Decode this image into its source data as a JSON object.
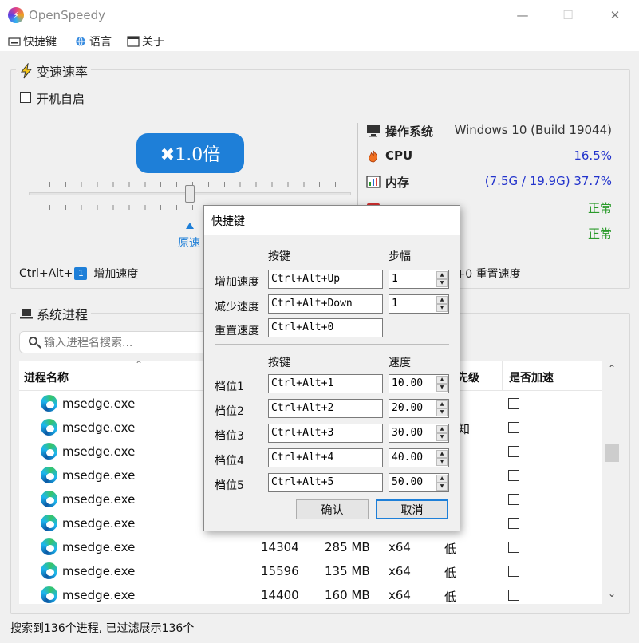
{
  "app": {
    "title": "OpenSpeedy",
    "logo_glyph": "⚡"
  },
  "window_controls": {
    "minimize": "—",
    "maximize": "☐",
    "close": "✕"
  },
  "menu": [
    {
      "label": "快捷键",
      "icon": "keyboard-icon"
    },
    {
      "label": "语言",
      "icon": "globe-icon"
    },
    {
      "label": "关于",
      "icon": "window-icon"
    }
  ],
  "speed_panel": {
    "title": "变速速率",
    "autostart_label": "开机自启",
    "autostart_checked": false,
    "speed_label": "✖1.0倍",
    "speed_value": 1.0,
    "slider_fraction": 0.5,
    "marker_label": "原速",
    "hotkey_prefix": "Ctrl+Alt+",
    "hotkey_key": "1",
    "hotkey_action": "增加速度",
    "reset_hotkey": "t+0 重置速度"
  },
  "system": {
    "rows": [
      {
        "label": "操作系统",
        "value": "Windows 10 (Build 19044)",
        "icon": "monitor-icon",
        "color": "#333333"
      },
      {
        "label": "CPU",
        "value": "16.5%",
        "icon": "flame-icon",
        "color": "#2233cc"
      },
      {
        "label": "内存",
        "value": "(7.5G / 19.9G) 37.7%",
        "icon": "chart-icon",
        "color": "#2233cc"
      },
      {
        "label": "",
        "value": "正常",
        "icon": "status-icon",
        "color": "#2a9a2a"
      },
      {
        "label": "",
        "value": "正常",
        "icon": "status-icon",
        "color": "#2a9a2a"
      }
    ]
  },
  "process_panel": {
    "title": "系统进程",
    "search_placeholder": "输入进程名搜索...",
    "columns": {
      "name": "进程名称",
      "priority": "先级",
      "accelerate": "是否加速"
    },
    "rows": [
      {
        "name": "msedge.exe",
        "pid": "",
        "mem": "",
        "arch": "",
        "priority": "",
        "accel": false
      },
      {
        "name": "msedge.exe",
        "pid": "",
        "mem": "",
        "arch": "",
        "priority": "知",
        "accel": false
      },
      {
        "name": "msedge.exe",
        "pid": "",
        "mem": "",
        "arch": "",
        "priority": "",
        "accel": false
      },
      {
        "name": "msedge.exe",
        "pid": "",
        "mem": "",
        "arch": "",
        "priority": "",
        "accel": false
      },
      {
        "name": "msedge.exe",
        "pid": "",
        "mem": "",
        "arch": "",
        "priority": "",
        "accel": false
      },
      {
        "name": "msedge.exe",
        "pid": "",
        "mem": "",
        "arch": "",
        "priority": "",
        "accel": false
      },
      {
        "name": "msedge.exe",
        "pid": "14304",
        "mem": "285 MB",
        "arch": "x64",
        "priority": "低",
        "accel": false
      },
      {
        "name": "msedge.exe",
        "pid": "15596",
        "mem": "135 MB",
        "arch": "x64",
        "priority": "低",
        "accel": false
      },
      {
        "name": "msedge.exe",
        "pid": "14400",
        "mem": "160 MB",
        "arch": "x64",
        "priority": "低",
        "accel": false
      }
    ],
    "status": "搜索到136个进程, 已过滤展示136个"
  },
  "dialog": {
    "title": "快捷键",
    "section1_key_header": "按键",
    "section1_step_header": "步幅",
    "actions": [
      {
        "label": "增加速度",
        "key": "Ctrl+Alt+Up",
        "step": "1"
      },
      {
        "label": "减少速度",
        "key": "Ctrl+Alt+Down",
        "step": "1"
      },
      {
        "label": "重置速度",
        "key": "Ctrl+Alt+0"
      }
    ],
    "section2_key_header": "按键",
    "section2_speed_header": "速度",
    "levels": [
      {
        "label": "档位1",
        "key": "Ctrl+Alt+1",
        "speed": "10.00"
      },
      {
        "label": "档位2",
        "key": "Ctrl+Alt+2",
        "speed": "20.00"
      },
      {
        "label": "档位3",
        "key": "Ctrl+Alt+3",
        "speed": "30.00"
      },
      {
        "label": "档位4",
        "key": "Ctrl+Alt+4",
        "speed": "40.00"
      },
      {
        "label": "档位5",
        "key": "Ctrl+Alt+5",
        "speed": "50.00"
      }
    ],
    "ok_label": "确认",
    "cancel_label": "取消"
  }
}
